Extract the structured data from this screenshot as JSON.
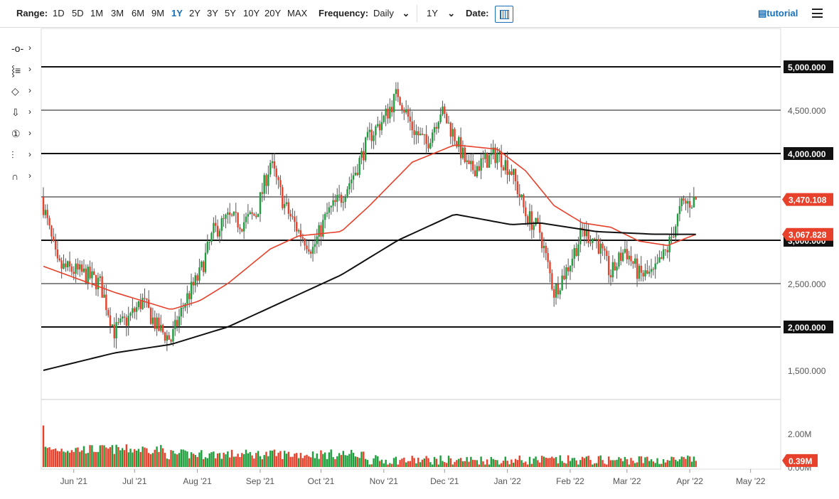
{
  "toolbar": {
    "range_label": "Range:",
    "ranges": [
      "1D",
      "5D",
      "1M",
      "3M",
      "6M",
      "9M",
      "1Y",
      "2Y",
      "3Y",
      "5Y",
      "10Y",
      "20Y",
      "MAX"
    ],
    "active_range": "1Y",
    "frequency_label": "Frequency:",
    "frequency": "Daily",
    "period": "1Y",
    "date_label": "Date:",
    "tutorial": "tutorial"
  },
  "tools": [
    "crosshair-icon",
    "line-tools-icon",
    "shapes-icon",
    "arrow-down-icon",
    "annotation-number-icon",
    "fibonacci-icon",
    "magnet-icon"
  ],
  "tool_glyphs": [
    "-o-",
    "⸾≡",
    "◇",
    "⇩",
    "①",
    "⫶",
    "∩"
  ],
  "colors": {
    "up": "#1f9e3e",
    "down": "#e8412b",
    "ma50": "#e8412b",
    "ma200": "#111111"
  },
  "chart_data": {
    "type": "candlestick",
    "ylim": [
      1200,
      5400
    ],
    "y_ticks": [
      "1,500.000",
      "2,000.000",
      "2,500.000",
      "3,000.000",
      "3,500.000",
      "4,000.000",
      "4,500.000",
      "5,000.000"
    ],
    "y_tick_values": [
      1500,
      2000,
      2500,
      3000,
      3500,
      4000,
      4500,
      5000
    ],
    "hlines": [
      2000,
      2500,
      3000,
      3500,
      4000,
      4500,
      5000
    ],
    "hlines_bold": [
      2000,
      3000,
      4000,
      5000
    ],
    "x_ticks": [
      "Jun '21",
      "Jul '21",
      "Aug '21",
      "Sep '21",
      "Oct '21",
      "Nov '21",
      "Dec '21",
      "Jan '22",
      "Feb '22",
      "Mar '22",
      "Apr '22",
      "May '22"
    ],
    "x_tick_dates": [
      "2021-06-01",
      "2021-07-01",
      "2021-08-01",
      "2021-09-01",
      "2021-10-01",
      "2021-11-01",
      "2021-12-01",
      "2022-01-01",
      "2022-02-01",
      "2022-03-01",
      "2022-04-01",
      "2022-05-01"
    ],
    "start_date": "2021-05-17",
    "end_date": "2022-04-04",
    "price_path": [
      [
        "2021-05-17",
        3400
      ],
      [
        "2021-05-24",
        2700
      ],
      [
        "2021-06-01",
        2650
      ],
      [
        "2021-06-07",
        2600
      ],
      [
        "2021-06-14",
        2500
      ],
      [
        "2021-06-21",
        1950
      ],
      [
        "2021-06-28",
        2100
      ],
      [
        "2021-07-05",
        2300
      ],
      [
        "2021-07-12",
        2000
      ],
      [
        "2021-07-19",
        1850
      ],
      [
        "2021-07-26",
        2300
      ],
      [
        "2021-08-02",
        2600
      ],
      [
        "2021-08-09",
        3100
      ],
      [
        "2021-08-16",
        3250
      ],
      [
        "2021-08-23",
        3200
      ],
      [
        "2021-08-30",
        3300
      ],
      [
        "2021-09-06",
        3900
      ],
      [
        "2021-09-13",
        3400
      ],
      [
        "2021-09-20",
        3100
      ],
      [
        "2021-09-27",
        2900
      ],
      [
        "2021-10-04",
        3300
      ],
      [
        "2021-10-11",
        3500
      ],
      [
        "2021-10-18",
        3800
      ],
      [
        "2021-10-25",
        4200
      ],
      [
        "2021-11-01",
        4400
      ],
      [
        "2021-11-08",
        4700
      ],
      [
        "2021-11-15",
        4300
      ],
      [
        "2021-11-22",
        4100
      ],
      [
        "2021-11-29",
        4500
      ],
      [
        "2021-12-06",
        4200
      ],
      [
        "2021-12-13",
        3800
      ],
      [
        "2021-12-20",
        3900
      ],
      [
        "2021-12-27",
        4000
      ],
      [
        "2022-01-03",
        3800
      ],
      [
        "2022-01-10",
        3300
      ],
      [
        "2022-01-17",
        3100
      ],
      [
        "2022-01-24",
        2400
      ],
      [
        "2022-01-31",
        2700
      ],
      [
        "2022-02-07",
        3100
      ],
      [
        "2022-02-14",
        3000
      ],
      [
        "2022-02-21",
        2600
      ],
      [
        "2022-02-28",
        2900
      ],
      [
        "2022-03-07",
        2600
      ],
      [
        "2022-03-14",
        2600
      ],
      [
        "2022-03-21",
        2900
      ],
      [
        "2022-03-28",
        3400
      ],
      [
        "2022-04-04",
        3470
      ]
    ],
    "ma50": [
      [
        "2021-05-17",
        2700
      ],
      [
        "2021-06-21",
        2400
      ],
      [
        "2021-07-19",
        2200
      ],
      [
        "2021-08-02",
        2300
      ],
      [
        "2021-08-16",
        2500
      ],
      [
        "2021-09-06",
        2900
      ],
      [
        "2021-09-20",
        3050
      ],
      [
        "2021-10-11",
        3100
      ],
      [
        "2021-10-25",
        3400
      ],
      [
        "2021-11-15",
        3900
      ],
      [
        "2021-12-06",
        4100
      ],
      [
        "2021-12-27",
        4050
      ],
      [
        "2022-01-10",
        3800
      ],
      [
        "2022-01-24",
        3400
      ],
      [
        "2022-02-07",
        3200
      ],
      [
        "2022-02-21",
        3150
      ],
      [
        "2022-03-07",
        2990
      ],
      [
        "2022-03-21",
        2940
      ],
      [
        "2022-04-04",
        3068
      ]
    ],
    "ma200": [
      [
        "2021-05-17",
        1500
      ],
      [
        "2021-06-21",
        1700
      ],
      [
        "2021-07-19",
        1800
      ],
      [
        "2021-08-16",
        2000
      ],
      [
        "2021-09-13",
        2300
      ],
      [
        "2021-10-11",
        2600
      ],
      [
        "2021-11-08",
        3000
      ],
      [
        "2021-12-06",
        3300
      ],
      [
        "2022-01-03",
        3180
      ],
      [
        "2022-01-17",
        3200
      ],
      [
        "2022-02-14",
        3100
      ],
      [
        "2022-03-14",
        3070
      ],
      [
        "2022-04-04",
        3068
      ]
    ],
    "last_price": "3,470.108",
    "ma_label": "3,067.828",
    "volume": {
      "ticks": [
        "2.00M",
        "0.00M"
      ],
      "tick_values": [
        2.0,
        0
      ],
      "last": "0.39M",
      "max": 2.7
    }
  }
}
